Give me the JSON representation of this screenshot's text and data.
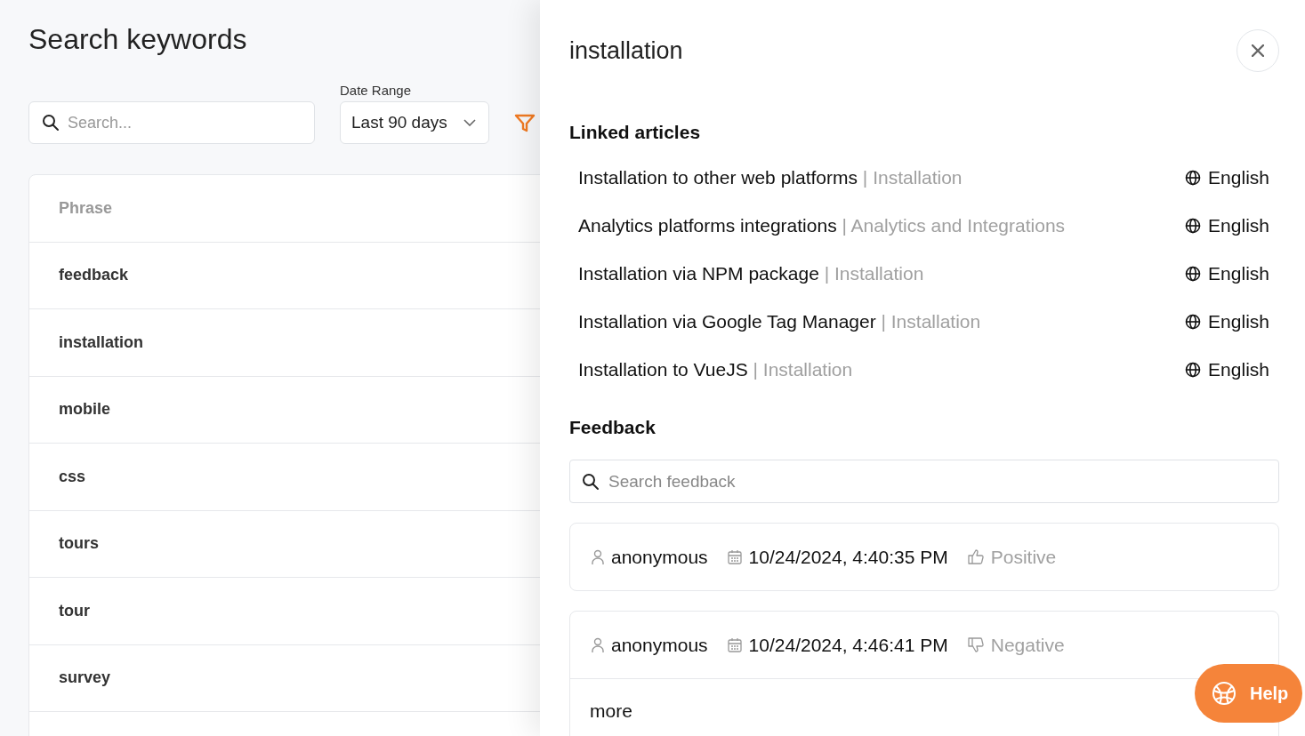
{
  "page": {
    "title": "Search keywords",
    "search": {
      "placeholder": "Search..."
    },
    "date_range": {
      "label": "Date Range",
      "value": "Last 90 days"
    }
  },
  "table": {
    "columns": [
      "Phrase"
    ],
    "rows": [
      "feedback",
      "installation",
      "mobile",
      "css",
      "tours",
      "tour",
      "survey"
    ]
  },
  "drawer": {
    "title": "installation",
    "linked_articles": {
      "heading": "Linked articles",
      "items": [
        {
          "title": "Installation to other web platforms",
          "category": "| Installation",
          "language": "English"
        },
        {
          "title": "Analytics platforms integrations",
          "category": "| Analytics and Integrations",
          "language": "English"
        },
        {
          "title": "Installation via NPM package",
          "category": "| Installation",
          "language": "English"
        },
        {
          "title": "Installation via Google Tag Manager",
          "category": "| Installation",
          "language": "English"
        },
        {
          "title": "Installation to VueJS",
          "category": "| Installation",
          "language": "English"
        }
      ]
    },
    "feedback": {
      "heading": "Feedback",
      "search": {
        "placeholder": "Search feedback"
      },
      "items": [
        {
          "user": "anonymous",
          "date": "10/24/2024, 4:40:35 PM",
          "kind": "positive",
          "rating": "Positive"
        },
        {
          "user": "anonymous",
          "date": "10/24/2024, 4:46:41 PM",
          "kind": "negative",
          "rating": "Negative",
          "comment": "more"
        }
      ]
    }
  },
  "help": {
    "label": "Help"
  }
}
